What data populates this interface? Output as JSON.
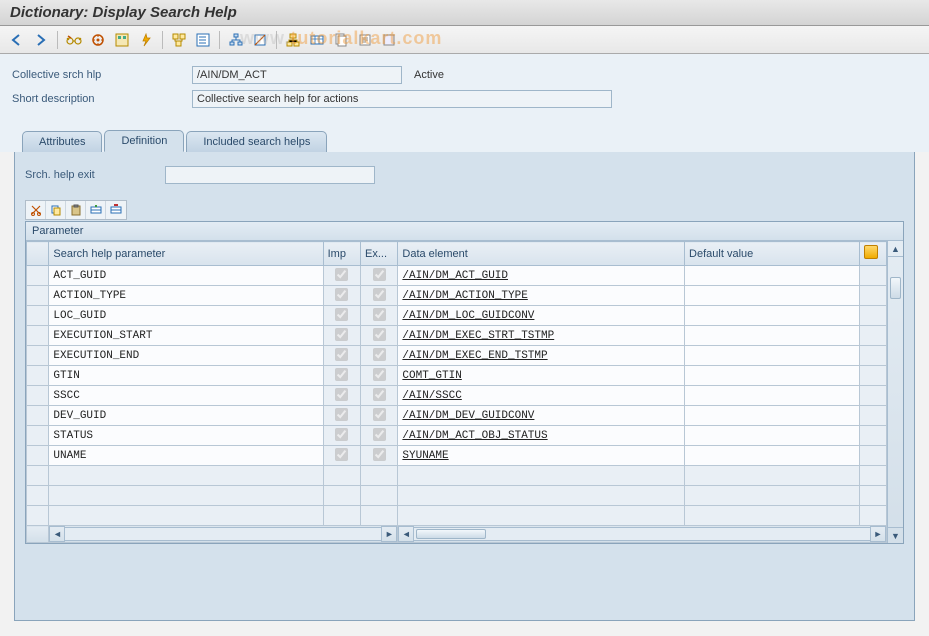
{
  "title": "Dictionary: Display Search Help",
  "watermark": "tutorialkart.com",
  "toolbar": {
    "icons": [
      "back-arrow-icon",
      "forward-arrow-icon",
      "sep",
      "glasses-change-icon",
      "other-object-icon",
      "check-icon",
      "activate-icon",
      "sep",
      "where-used-icon",
      "sep",
      "display-list-icon",
      "sep",
      "hierarchy-icon",
      "sep",
      "append-icon",
      "graphic-icon",
      "tech-settings-icon",
      "contents-icon",
      "documentation-icon"
    ]
  },
  "header": {
    "coll_label": "Collective srch hlp",
    "coll_value": "/AIN/DM_ACT",
    "status": "Active",
    "desc_label": "Short description",
    "desc_value": "Collective search help for actions"
  },
  "tabs": {
    "items": [
      "Attributes",
      "Definition",
      "Included search helps"
    ],
    "active": 1
  },
  "definition": {
    "exit_label": "Srch. help exit",
    "exit_value": "",
    "mini_icons": [
      "cut-icon",
      "copy-icon",
      "paste-icon",
      "insert-row-icon",
      "delete-row-icon"
    ],
    "grid_title": "Parameter",
    "columns": {
      "param": "Search help parameter",
      "imp": "Imp",
      "exp": "Ex...",
      "elem": "Data element",
      "def": "Default value"
    },
    "rows": [
      {
        "param": "ACT_GUID",
        "imp": true,
        "exp": true,
        "elem": "/AIN/DM_ACT_GUID",
        "def": ""
      },
      {
        "param": "ACTION_TYPE",
        "imp": true,
        "exp": true,
        "elem": "/AIN/DM_ACTION_TYPE",
        "def": ""
      },
      {
        "param": "LOC_GUID",
        "imp": true,
        "exp": true,
        "elem": "/AIN/DM_LOC_GUIDCONV",
        "def": ""
      },
      {
        "param": "EXECUTION_START",
        "imp": true,
        "exp": true,
        "elem": "/AIN/DM_EXEC_STRT_TSTMP",
        "def": ""
      },
      {
        "param": "EXECUTION_END",
        "imp": true,
        "exp": true,
        "elem": "/AIN/DM_EXEC_END_TSTMP",
        "def": ""
      },
      {
        "param": "GTIN",
        "imp": true,
        "exp": true,
        "elem": "COMT_GTIN",
        "def": ""
      },
      {
        "param": "SSCC",
        "imp": true,
        "exp": true,
        "elem": "/AIN/SSCC",
        "def": ""
      },
      {
        "param": "DEV_GUID",
        "imp": true,
        "exp": true,
        "elem": "/AIN/DM_DEV_GUIDCONV",
        "def": ""
      },
      {
        "param": "STATUS",
        "imp": true,
        "exp": true,
        "elem": "/AIN/DM_ACT_OBJ_STATUS",
        "def": ""
      },
      {
        "param": "UNAME",
        "imp": true,
        "exp": true,
        "elem": "SYUNAME",
        "def": ""
      }
    ],
    "empty_rows": 3
  }
}
